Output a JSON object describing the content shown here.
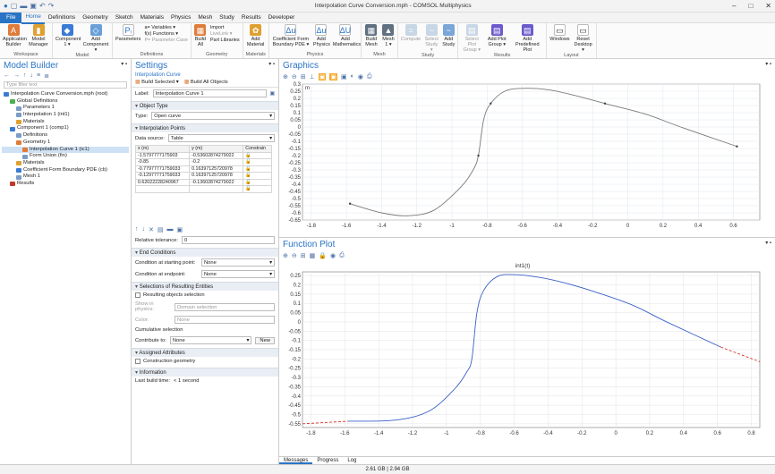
{
  "window": {
    "title": "Interpolation Curve Conversion.mph - COMSOL Multiphysics"
  },
  "menu": [
    "File",
    "Home",
    "Definitions",
    "Geometry",
    "Sketch",
    "Materials",
    "Physics",
    "Mesh",
    "Study",
    "Results",
    "Developer"
  ],
  "ribbon": {
    "workspace": {
      "label": "Workspace",
      "b1": "Application Builder",
      "b2": "Model Manager"
    },
    "model": {
      "label": "Model",
      "b1": "Component 1 ▾",
      "b2": "Add Component ▾"
    },
    "definitions": {
      "label": "Definitions",
      "b1": "Parameters",
      "s1": "a= Variables ▾",
      "s2": "f(x) Functions ▾",
      "s3": "P= Parameter Case"
    },
    "geometry": {
      "label": "Geometry",
      "b1": "Build All",
      "s1": "Import",
      "s2": "LiveLink ▾",
      "s3": "Part Libraries"
    },
    "materials": {
      "label": "Materials",
      "b1": "Add Material"
    },
    "physics": {
      "label": "Physics",
      "b1": "Coefficient Form Boundary PDE ▾",
      "b2": "Add Physics",
      "b3": "Add Mathematics"
    },
    "mesh": {
      "label": "Mesh",
      "b1": "Build Mesh",
      "b2": "Mesh 1 ▾"
    },
    "study": {
      "label": "Study",
      "b1": "Compute",
      "b2": "Select Study ▾",
      "b3": "Add Study"
    },
    "results": {
      "label": "Results",
      "b1": "Select Plot Group ▾",
      "b2": "Add Plot Group ▾",
      "b3": "Add Predefined Plot"
    },
    "layout": {
      "label": "Layout",
      "b1": "Windows",
      "b2": "Reset Desktop ▾"
    }
  },
  "model_builder": {
    "title": "Model Builder",
    "filter_placeholder": "Type filter text",
    "tree": [
      {
        "label": "Interpolation Curve Conversion.mph (root)",
        "depth": 0,
        "color": "#3a7bd5"
      },
      {
        "label": "Global Definitions",
        "depth": 1,
        "color": "#4caf50"
      },
      {
        "label": "Parameters 1",
        "depth": 2,
        "color": "#7a9cc6"
      },
      {
        "label": "Interpolation 1 (int1)",
        "depth": 2,
        "color": "#7a9cc6"
      },
      {
        "label": "Materials",
        "depth": 2,
        "color": "#e0a030"
      },
      {
        "label": "Component 1 (comp1)",
        "depth": 1,
        "color": "#3a7bd5"
      },
      {
        "label": "Definitions",
        "depth": 2,
        "color": "#7a9cc6"
      },
      {
        "label": "Geometry 1",
        "depth": 2,
        "color": "#e07b39"
      },
      {
        "label": "Interpolation Curve 1 (ic1)",
        "depth": 3,
        "color": "#e07b39",
        "selected": true
      },
      {
        "label": "Form Union (fin)",
        "depth": 3,
        "color": "#7a9cc6"
      },
      {
        "label": "Materials",
        "depth": 2,
        "color": "#e0a030"
      },
      {
        "label": "Coefficient Form Boundary PDE (cb)",
        "depth": 2,
        "color": "#3a7bd5"
      },
      {
        "label": "Mesh 1",
        "depth": 2,
        "color": "#7a9cc6"
      },
      {
        "label": "Results",
        "depth": 1,
        "color": "#c0392b"
      }
    ]
  },
  "settings": {
    "title": "Settings",
    "subtitle": "Interpolation Curve",
    "build_selected": "Build Selected ▾",
    "build_all": "Build All Objects",
    "label_caption": "Label:",
    "label_value": "Interpolation Curve 1",
    "object_type_section": "Object Type",
    "type_caption": "Type:",
    "type_value": "Open curve",
    "interp_section": "Interpolation Points",
    "data_source_caption": "Data source:",
    "data_source_value": "Table",
    "table_headers": [
      "x (m)",
      "y (m)",
      "Constrain"
    ],
    "table_rows": [
      [
        "-1.5797777175903",
        "-0.53602874279022"
      ],
      [
        "-0.85",
        "-0.2"
      ],
      [
        "-0.77977771759033",
        "0.16397125720978"
      ],
      [
        "-0.12977771759033",
        "0.16397125720978"
      ],
      [
        "0.62022228240967",
        "-0.13602874279022"
      ]
    ],
    "rel_tol_caption": "Relative tolerance:",
    "rel_tol_value": "0",
    "end_section": "End Conditions",
    "start_caption": "Condition at starting point:",
    "start_value": "None",
    "end_caption": "Condition at endpoint:",
    "end_value": "None",
    "sel_section": "Selections of Resulting Entities",
    "resulting_sel": "Resulting objects selection",
    "show_physics_caption": "Show in physics:",
    "show_physics_value": "Domain selection",
    "color_caption": "Color:",
    "color_value": "None",
    "cumulative": "Cumulative selection",
    "contribute_caption": "Contribute to:",
    "contribute_value": "None",
    "new_btn": "New",
    "assigned_section": "Assigned Attributes",
    "construction": "Construction geometry",
    "info_section": "Information",
    "build_time_caption": "Last build time:",
    "build_time_value": "< 1 second"
  },
  "graphics": {
    "title": "Graphics",
    "unit": "m",
    "xticks": [
      "-1.8",
      "-1.6",
      "-1.4",
      "-1.2",
      "-1",
      "-0.8",
      "-0.6",
      "-0.4",
      "-0.2",
      "0",
      "0.2",
      "0.4",
      "0.6"
    ],
    "yticks": [
      "0.3",
      "0.25",
      "0.2",
      "0.15",
      "0.1",
      "0.05",
      "0",
      "-0.05",
      "-0.1",
      "-0.15",
      "-0.2",
      "-0.25",
      "-0.3",
      "-0.35",
      "-0.4",
      "-0.45",
      "-0.5",
      "-0.55",
      "-0.6",
      "-0.65"
    ]
  },
  "function_plot": {
    "title": "Function Plot",
    "plot_title": "int1(t)",
    "xticks": [
      "-1.8",
      "-1.6",
      "-1.4",
      "-1.2",
      "-1",
      "-0.8",
      "-0.6",
      "-0.4",
      "-0.2",
      "0",
      "0.2",
      "0.4",
      "0.6",
      "0.8"
    ],
    "yticks": [
      "0.25",
      "0.2",
      "0.15",
      "0.1",
      "0.05",
      "0",
      "-0.05",
      "-0.1",
      "-0.15",
      "-0.2",
      "-0.25",
      "-0.3",
      "-0.35",
      "-0.4",
      "-0.45",
      "-0.5",
      "-0.55"
    ],
    "colors": {
      "curve": "#3b5fc8",
      "extrapolation": "#d9332b"
    }
  },
  "bottom_tabs": [
    "Messages",
    "Progress",
    "Log"
  ],
  "status": {
    "memory": "2.61 GB | 2.94 GB"
  },
  "chart_data": [
    {
      "type": "line",
      "title": "",
      "xlabel": "",
      "ylabel": "",
      "xlim": [
        -1.85,
        0.75
      ],
      "ylim": [
        -0.65,
        0.3
      ],
      "series": [
        {
          "x": [
            -1.58,
            -1.4,
            -1.25,
            -1.1,
            -0.95,
            -0.88,
            -0.85,
            -0.82,
            -0.78,
            -0.7,
            -0.6,
            -0.45,
            -0.3,
            -0.13,
            0.1,
            0.3,
            0.62
          ],
          "y": [
            -0.536,
            -0.6,
            -0.62,
            -0.58,
            -0.42,
            -0.3,
            -0.2,
            0.05,
            0.164,
            0.25,
            0.27,
            0.26,
            0.22,
            0.164,
            0.09,
            0.0,
            -0.136
          ]
        }
      ]
    },
    {
      "type": "line",
      "title": "int1(t)",
      "xlabel": "",
      "ylabel": "",
      "xlim": [
        -1.85,
        0.85
      ],
      "ylim": [
        -0.57,
        0.27
      ],
      "series": [
        {
          "x": [
            -1.85,
            -1.58
          ],
          "y": [
            -0.55,
            -0.536
          ]
        },
        {
          "x": [
            -1.58,
            -1.3,
            -1.1,
            -0.95,
            -0.88,
            -0.85,
            -0.82,
            -0.78,
            -0.7,
            -0.6,
            -0.45,
            -0.3,
            -0.13,
            0.1,
            0.3,
            0.62
          ],
          "y": [
            -0.536,
            -0.53,
            -0.48,
            -0.36,
            -0.27,
            -0.2,
            0.05,
            0.17,
            0.245,
            0.255,
            0.24,
            0.21,
            0.164,
            0.09,
            0.0,
            -0.136
          ]
        },
        {
          "x": [
            0.62,
            0.85
          ],
          "y": [
            -0.136,
            -0.215
          ]
        }
      ]
    }
  ]
}
